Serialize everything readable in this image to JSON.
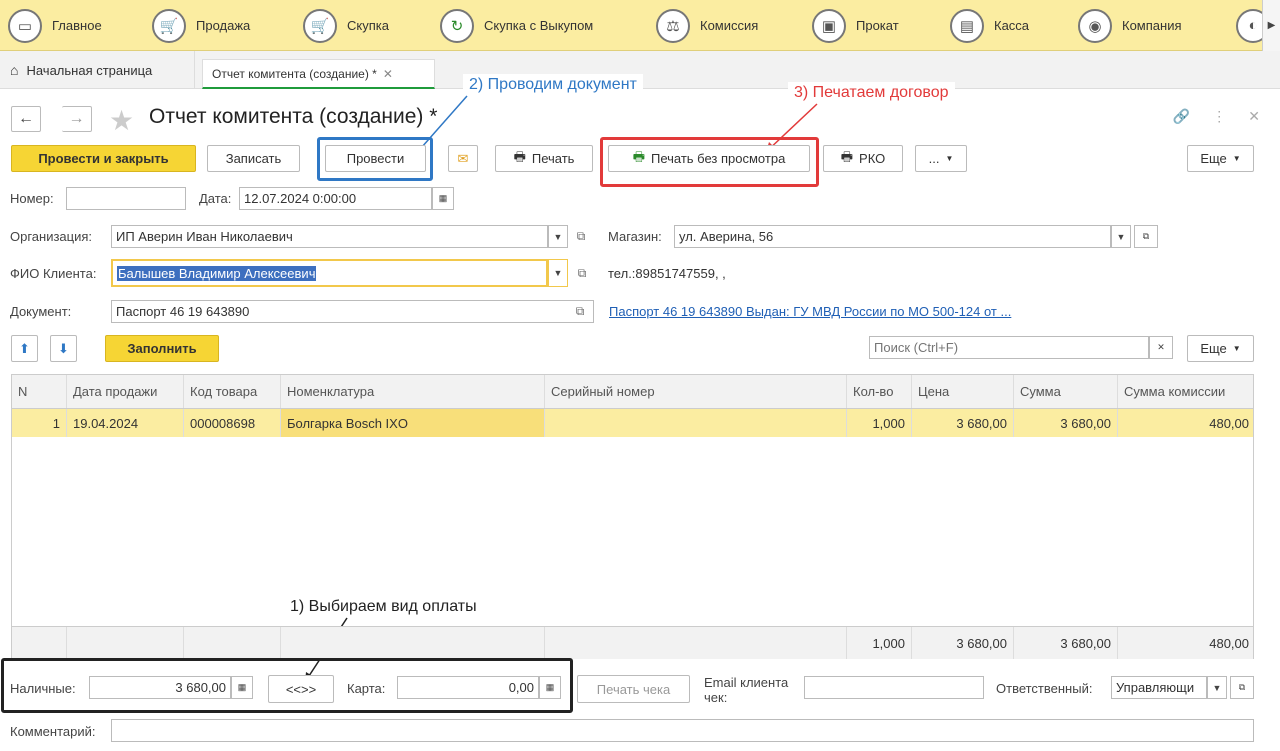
{
  "sections": [
    {
      "label": "Главное",
      "icon": "terminal-icon"
    },
    {
      "label": "Продажа",
      "icon": "cart-icon"
    },
    {
      "label": "Скупка",
      "icon": "cart-down-icon"
    },
    {
      "label": "Скупка с Выкупом",
      "icon": "cycle-icon"
    },
    {
      "label": "Комиссия",
      "icon": "scales-icon"
    },
    {
      "label": "Прокат",
      "icon": "rent-icon"
    },
    {
      "label": "Касса",
      "icon": "cash-register-icon"
    },
    {
      "label": "Компания",
      "icon": "company-icon"
    }
  ],
  "tabs": {
    "home": "Начальная страница",
    "active": "Отчет комитента (создание) *"
  },
  "title": "Отчет комитента (создание) *",
  "callouts": {
    "post": "2) Проводим документ",
    "print": "3) Печатаем договор",
    "payment": "1) Выбираем вид оплаты"
  },
  "toolbar": {
    "post_close": "Провести и закрыть",
    "save": "Записать",
    "post": "Провести",
    "print": "Печать",
    "print_no_preview": "Печать без просмотра",
    "rko": "РКО",
    "more_dots": "...",
    "more": "Еще"
  },
  "form": {
    "number_label": "Номер:",
    "number_value": "",
    "date_label": "Дата:",
    "date_value": "12.07.2024  0:00:00",
    "org_label": "Организация:",
    "org_value": "ИП Аверин Иван Николаевич",
    "shop_label": "Магазин:",
    "shop_value": "ул. Аверина, 56",
    "client_label": "ФИО Клиента:",
    "client_value": "Балышев Владимир Алексеевич",
    "phone": "тел.:89851747559, ,",
    "doc_label": "Документ:",
    "doc_value": "Паспорт 46 19 643890",
    "doc_link": "Паспорт 46 19 643890 Выдан: ГУ МВД России по МО 500-124 от ..."
  },
  "table_bar": {
    "fill": "Заполнить",
    "search_placeholder": "Поиск (Ctrl+F)",
    "more": "Еще"
  },
  "table": {
    "columns": [
      "N",
      "Дата продажи",
      "Код товара",
      "Номенклатура",
      "Серийный номер",
      "Кол-во",
      "Цена",
      "Сумма",
      "Сумма комиссии"
    ],
    "rows": [
      {
        "n": "1",
        "date": "19.04.2024",
        "code": "000008698",
        "item": "Болгарка Bosch IXO",
        "serial": "",
        "qty": "1,000",
        "price": "3 680,00",
        "sum": "3 680,00",
        "commission": "480,00"
      }
    ],
    "totals": {
      "qty": "1,000",
      "price": "3 680,00",
      "sum": "3 680,00",
      "commission": "480,00"
    }
  },
  "payment": {
    "cash_label": "Наличные:",
    "cash_value": "3 680,00",
    "swap": "<<>>",
    "card_label": "Карта:",
    "card_value": "0,00",
    "print_check": "Печать чека",
    "email_label_1": "Email клиента",
    "email_label_2": "чек:",
    "email_value": "",
    "responsible_label": "Ответственный:",
    "responsible_value": "Управляющи"
  },
  "comment_label": "Комментарий:",
  "comment_value": "",
  "colors": {
    "accent_yellow": "#f6d534",
    "highlight_blue": "#2f78c5",
    "highlight_red": "#e23a3a",
    "tab_green": "#1f9b3b"
  }
}
